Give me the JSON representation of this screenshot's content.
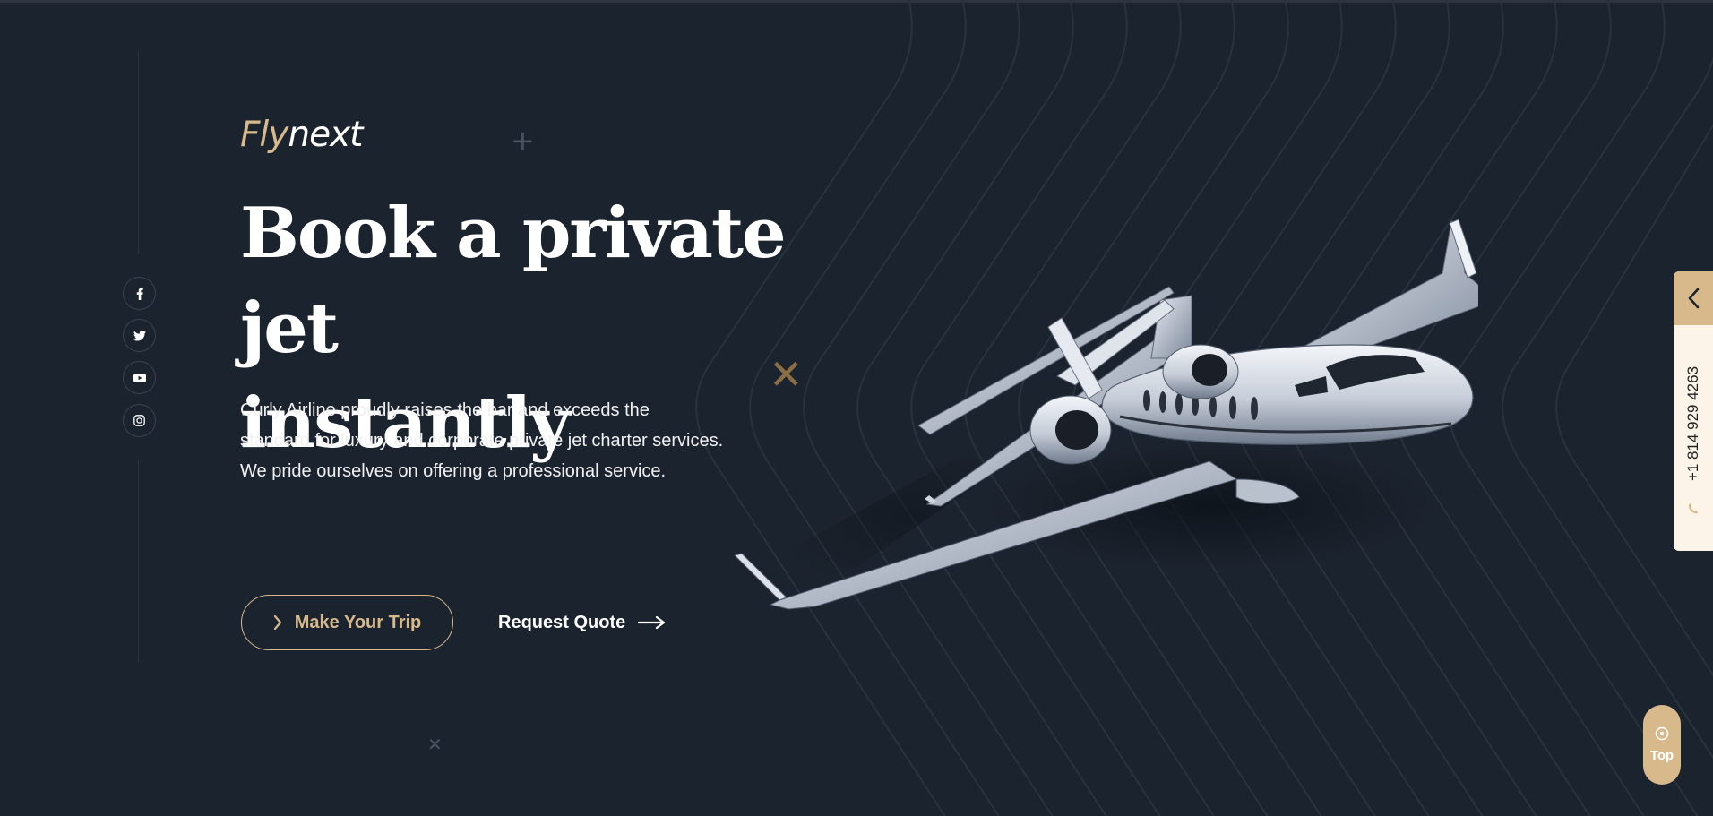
{
  "brand": {
    "part1": "Fly",
    "part2": "next"
  },
  "hero": {
    "line1": "Book a private jet",
    "line2": "instantly",
    "description": "Curly Airline proudly raises the bar and exceeds the standard for luxury and corporate private jet charter services. We pride ourselves on offering a professional service."
  },
  "buttons": {
    "trip": "Make Your Trip",
    "quote": "Request Quote"
  },
  "social": [
    "facebook-icon",
    "twitter-icon",
    "youtube-icon",
    "instagram-icon"
  ],
  "sidebar": {
    "phone": "+1 814 929 4263"
  },
  "scroll_top": {
    "label": "Top"
  },
  "colors": {
    "background": "#1b232e",
    "accent": "#d7b98c",
    "text": "#ffffff",
    "tab_bg": "#fcf4e8"
  }
}
